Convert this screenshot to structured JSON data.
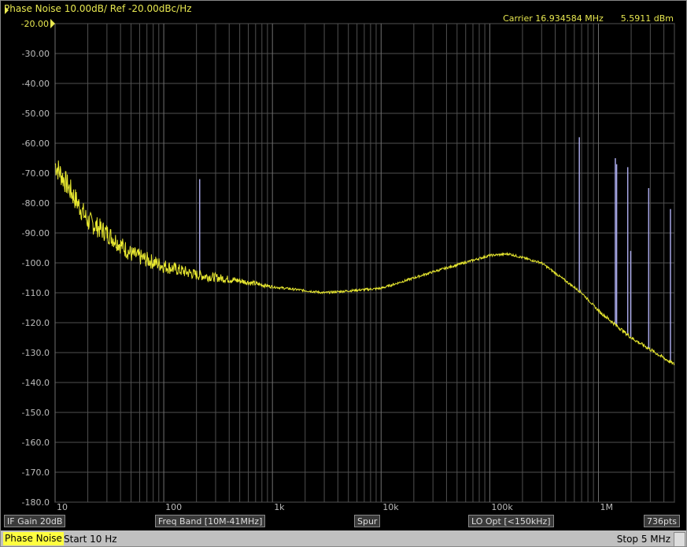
{
  "header": {
    "title": "Phase Noise 10.00dB/ Ref -20.00dBc/Hz",
    "ref_label": "-20.00",
    "carrier_label": "Carrier 16.934584 MHz",
    "carrier_power": "5.5911 dBm"
  },
  "softkeys": {
    "if_gain": "IF Gain 20dB",
    "freq_band": "Freq Band [10M-41MHz]",
    "spur": "Spur",
    "lo_opt": "LO Opt [<150kHz]",
    "points": "736pts"
  },
  "status": {
    "mode": "Phase Noise",
    "start": "Start 10 Hz",
    "stop": "Stop 5 MHz"
  },
  "colors": {
    "trace": "#e8e830",
    "spur": "#a8a8e8",
    "grid": "#505050"
  },
  "chart_data": {
    "type": "line",
    "title": "Phase Noise 10.00dB/ Ref -20.00dBc/Hz",
    "xscale": "log",
    "xlim": [
      10,
      5000000
    ],
    "ylim": [
      -180,
      -20
    ],
    "yticks": [
      "-20.00",
      "-30.00",
      "-40.00",
      "-50.00",
      "-60.00",
      "-70.00",
      "-80.00",
      "-90.00",
      "-100.0",
      "-110.0",
      "-120.0",
      "-130.0",
      "-140.0",
      "-150.0",
      "-160.0",
      "-170.0",
      "-180.0"
    ],
    "xticks": [
      {
        "v": 10,
        "label": "10"
      },
      {
        "v": 100,
        "label": "100"
      },
      {
        "v": 1000,
        "label": "1k"
      },
      {
        "v": 10000,
        "label": "10k"
      },
      {
        "v": 100000,
        "label": "100k"
      },
      {
        "v": 1000000,
        "label": "1M"
      }
    ],
    "grid": true,
    "series": [
      {
        "name": "Phase Noise",
        "points": [
          [
            10,
            -67
          ],
          [
            15,
            -78
          ],
          [
            20,
            -86
          ],
          [
            30,
            -90
          ],
          [
            50,
            -97
          ],
          [
            100,
            -101
          ],
          [
            200,
            -104
          ],
          [
            500,
            -106
          ],
          [
            1000,
            -108
          ],
          [
            3000,
            -110
          ],
          [
            10000,
            -108.5
          ],
          [
            30000,
            -103
          ],
          [
            100000,
            -97.5
          ],
          [
            150000,
            -97
          ],
          [
            300000,
            -100
          ],
          [
            700000,
            -110
          ],
          [
            1000000,
            -116
          ],
          [
            2000000,
            -125
          ],
          [
            5000000,
            -134
          ]
        ]
      }
    ],
    "spurs": [
      [
        214,
        -72
      ],
      [
        667000,
        -58
      ],
      [
        1430000,
        -65
      ],
      [
        1470000,
        -67
      ],
      [
        1860000,
        -68
      ],
      [
        1980000,
        -96
      ],
      [
        2900000,
        -75
      ],
      [
        4600000,
        -82
      ]
    ]
  }
}
